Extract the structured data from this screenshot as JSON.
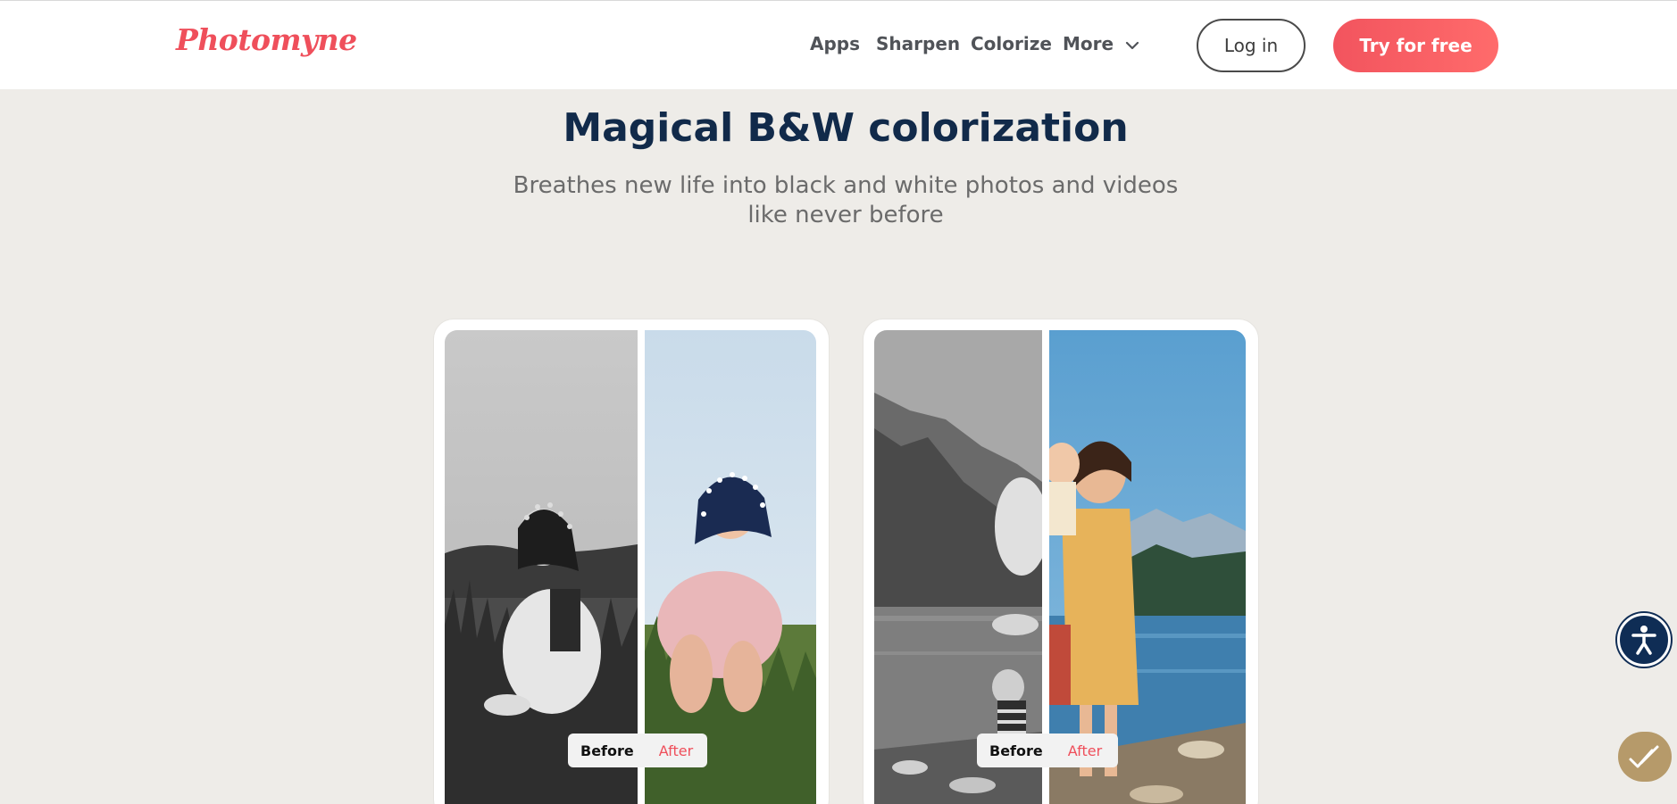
{
  "header": {
    "logo": "Photomyne",
    "nav": {
      "apps": "Apps",
      "sharpen": "Sharpen",
      "colorize": "Colorize",
      "more": "More"
    },
    "login": "Log in",
    "try_free": "Try for free"
  },
  "hero": {
    "title": "Magical B&W colorization",
    "subtitle": "Breathes new life into black and white photos and videos like never before"
  },
  "cards": [
    {
      "before_label": "Before",
      "after_label": "After"
    },
    {
      "before_label": "Before",
      "after_label": "After"
    }
  ],
  "colors": {
    "brand": "#ef4f5b",
    "heading": "#112a4a",
    "accessibility": "#0f2d55",
    "background": "#eeece8"
  },
  "icons": {
    "more_chevron": "chevron-down-icon",
    "accessibility": "accessibility-icon",
    "check": "checkmark-icon"
  }
}
